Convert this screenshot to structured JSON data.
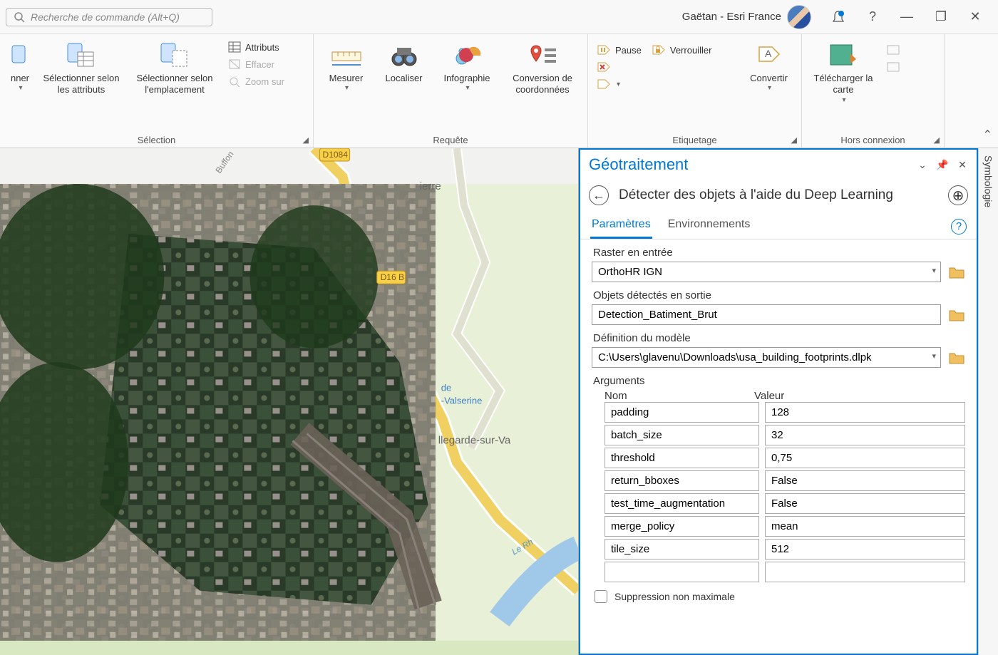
{
  "titlebar": {
    "search_placeholder": "Recherche de commande (Alt+Q)",
    "user_label": "Gaëtan - Esri France",
    "help": "?",
    "minimize": "—",
    "restore": "❐",
    "close": "✕"
  },
  "ribbon": {
    "groups": {
      "selection": {
        "label": "Sélection",
        "btn0": "nner",
        "btn1": "Sélectionner selon les attributs",
        "btn2": "Sélectionner selon l'emplacement",
        "small1": "Attributs",
        "small2": "Effacer",
        "small3": "Zoom sur"
      },
      "requete": {
        "label": "Requête",
        "b1": "Mesurer",
        "b2": "Localiser",
        "b3": "Infographie",
        "b4": "Conversion de coordonnées"
      },
      "etiquetage": {
        "label": "Etiquetage",
        "s1": "Pause",
        "s2": "Verrouiller",
        "conv": "Convertir"
      },
      "hors": {
        "label": "Hors connexion",
        "dl": "Télécharger la carte"
      }
    }
  },
  "map_labels": {
    "d1084": "D1084",
    "buffon": "Buffon",
    "d16b": "D16 B",
    "ierre": "ierre",
    "de": "de",
    "vals": "-Valserine",
    "bell": "llegarde-sur-Va",
    "rhone": "Le Rh"
  },
  "pane": {
    "title": "Géotraitement",
    "tool_name": "Détecter des objets à l'aide du Deep Learning",
    "tabs": {
      "params": "Paramètres",
      "envs": "Environnements"
    },
    "fields": {
      "raster_label": "Raster en entrée",
      "raster_value": "OrthoHR IGN",
      "output_label": "Objets détectés en sortie",
      "output_value": "Detection_Batiment_Brut",
      "model_label": "Définition du modèle",
      "model_value": "C:\\Users\\glavenu\\Downloads\\usa_building_footprints.dlpk",
      "args_label": "Arguments",
      "col_name": "Nom",
      "col_value": "Valeur"
    },
    "arguments": [
      {
        "name": "padding",
        "value": "128"
      },
      {
        "name": "batch_size",
        "value": "32"
      },
      {
        "name": "threshold",
        "value": "0,75"
      },
      {
        "name": "return_bboxes",
        "value": "False"
      },
      {
        "name": "test_time_augmentation",
        "value": "False"
      },
      {
        "name": "merge_policy",
        "value": "mean"
      },
      {
        "name": "tile_size",
        "value": "512"
      },
      {
        "name": "",
        "value": ""
      }
    ],
    "nms": "Suppression non maximale"
  },
  "side_tab": "Symbologie"
}
